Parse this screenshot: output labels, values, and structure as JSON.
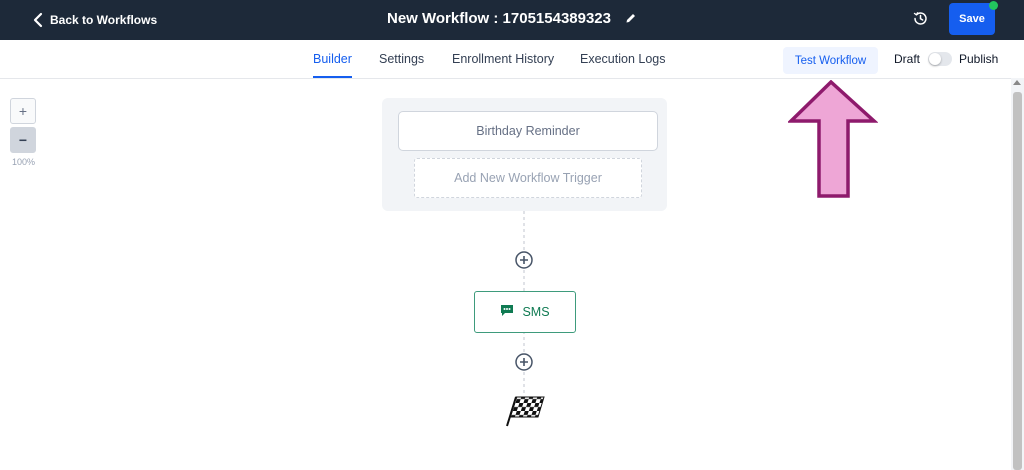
{
  "header": {
    "back_label": "Back to Workflows",
    "workflow_title": "New Workflow : 1705154389323",
    "save_label": "Save"
  },
  "tabs": [
    {
      "label": "Builder",
      "active": true
    },
    {
      "label": "Settings",
      "active": false
    },
    {
      "label": "Enrollment History",
      "active": false
    },
    {
      "label": "Execution Logs",
      "active": false
    }
  ],
  "actions": {
    "test_label": "Test Workflow",
    "draft_label": "Draft",
    "publish_label": "Publish",
    "published": false
  },
  "zoom": {
    "in_label": "+",
    "out_label": "−",
    "level": "100%"
  },
  "canvas": {
    "trigger_label": "Birthday Reminder",
    "add_trigger_label": "Add New Workflow Trigger",
    "action_label": "SMS"
  },
  "colors": {
    "topbar": "#1d2939",
    "accent": "#155eef",
    "sms_green": "#0f7a52",
    "annotation_fill": "#eea6d6",
    "annotation_stroke": "#8e1a6c"
  },
  "icons": {
    "back": "chevron-left-icon",
    "edit": "pencil-icon",
    "history": "clock-history-icon",
    "sms": "chat-message-icon",
    "add_step": "plus-circle-icon",
    "end": "checkered-flag-icon"
  }
}
